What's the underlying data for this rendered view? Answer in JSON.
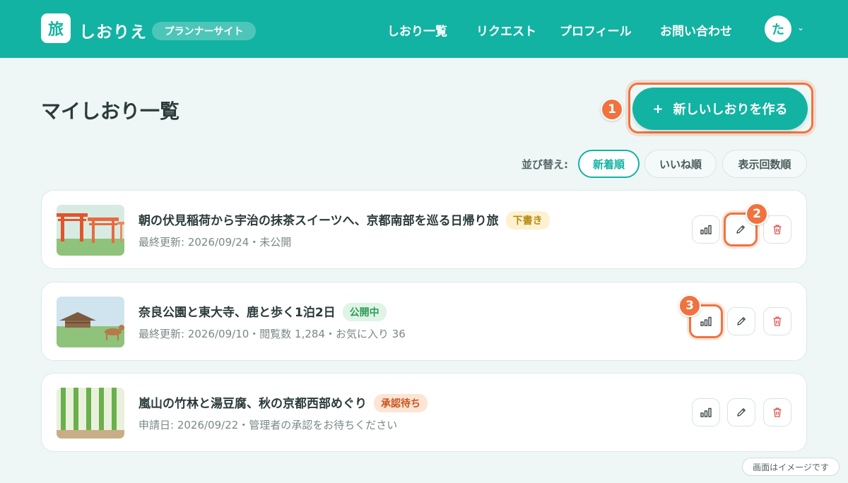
{
  "header": {
    "logo_char": "旅",
    "brand": "しおりえ",
    "badge": "プランナーサイト",
    "nav": [
      "しおり一覧",
      "リクエスト",
      "プロフィール",
      "お問い合わせ"
    ],
    "avatar_char": "た",
    "avatar_caret": "⌄",
    "accent_color": "#12b3a2"
  },
  "main": {
    "title": "マイしおり一覧",
    "new_button": {
      "plus": "+",
      "label": "新しいしおりを作る"
    },
    "sort": {
      "label": "並び替え:",
      "options": [
        "新着順",
        "いいね順",
        "表示回数順"
      ],
      "active": "新着順"
    },
    "cards": [
      {
        "title": "朝の伏見稲荷から宇治の抹茶スイーツへ、京都南部を巡る日帰り旅",
        "badge": "下書き",
        "meta": "最終更新: 2026/09/24・未公開",
        "thumb": "torii"
      },
      {
        "title": "奈良公園と東大寺、鹿と歩く1泊2日",
        "badge": "公開中",
        "meta": "最終更新: 2026/09/10・閲覧数 1,284・お気に入り 36",
        "thumb": "temple-deer"
      },
      {
        "title": "嵐山の竹林と湯豆腐、秋の京都西部めぐり",
        "badge": "承認待ち",
        "meta": "申請日: 2026/09/22・管理者の承認をお待ちください",
        "thumb": "bamboo"
      }
    ]
  },
  "markers": [
    "1",
    "2",
    "3"
  ],
  "footnote": "画面はイメージです",
  "colors": {
    "accent": "#12b3a2",
    "highlight": "#f0733f",
    "background": "#eef7f6"
  }
}
